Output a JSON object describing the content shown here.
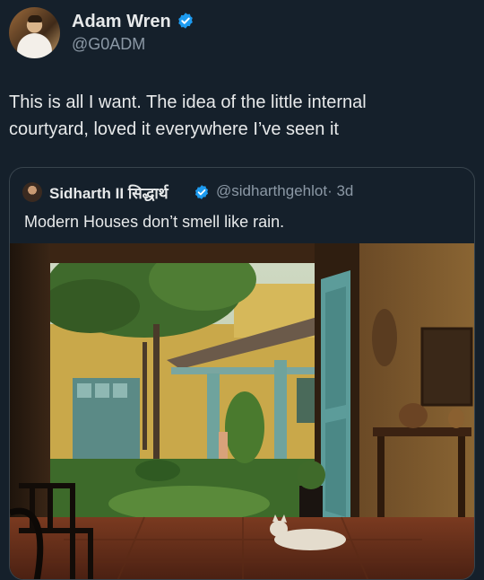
{
  "tweet": {
    "author": {
      "name": "Adam Wren",
      "handle": "@G0ADM"
    },
    "text_line1": "This is all I want. The idea of the little internal",
    "text_line2": "courtyard, loved it everywhere I’ve seen it"
  },
  "quote": {
    "author": {
      "name": "Sidharth II सिद्धार्थ",
      "handle": "@sidharthgehlot",
      "time": "· 3d"
    },
    "text": "Modern Houses don’t smell like rain."
  },
  "colors": {
    "background": "#15202b",
    "verified": "#1d9bf0",
    "muted": "#8b98a5"
  }
}
